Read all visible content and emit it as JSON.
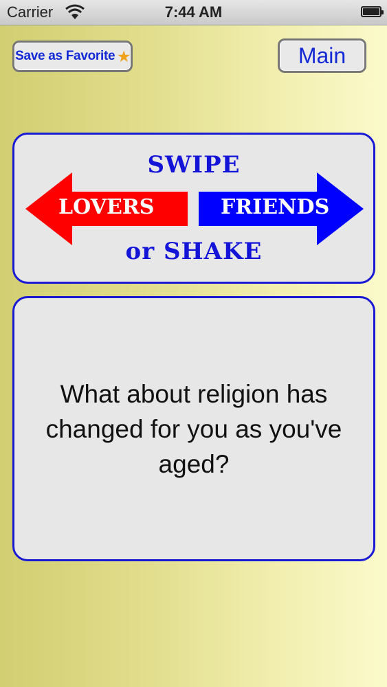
{
  "status_bar": {
    "carrier": "Carrier",
    "time": "7:44 AM"
  },
  "buttons": {
    "favorite_label": "Save as Favorite",
    "main_label": "Main"
  },
  "swipe_panel": {
    "top_text": "SWIPE",
    "left_arrow_label": "LOVERS",
    "right_arrow_label": "FRIENDS",
    "bottom_text": "or SHAKE",
    "left_color": "#ff0000",
    "right_color": "#0000ff"
  },
  "question": {
    "text": "What about religion has changed for you as you've aged?"
  },
  "icons": {
    "wifi": "wifi-icon",
    "battery": "battery-icon",
    "star": "star-icon"
  }
}
